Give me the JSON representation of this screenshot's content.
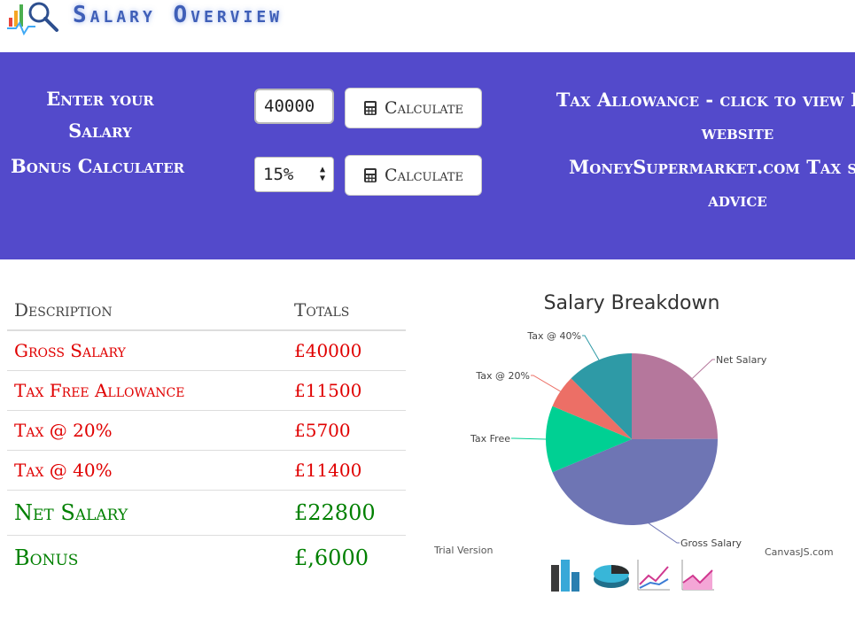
{
  "header": {
    "title": "Salary Overview",
    "logo_icon": "chart-magnifier-icon"
  },
  "banner": {
    "salary_label": "Enter your Salary",
    "salary_value": "40000",
    "bonus_label": "Bonus Calculater",
    "bonus_selected": "15%",
    "calc_button_label": "Calculate",
    "calc_icon": "calculator-icon",
    "links": [
      "Tax Allowance - click to view HMRC website",
      "MoneySupermarket.com Tax saving advice"
    ],
    "background": "#534acb"
  },
  "table": {
    "headers": [
      "Description",
      "Totals"
    ],
    "rows": [
      {
        "label": "Gross Salary",
        "value": "£40000",
        "color": "red"
      },
      {
        "label": "Tax Free Allowance",
        "value": "£11500",
        "color": "red"
      },
      {
        "label": "Tax @ 20%",
        "value": "£5700",
        "color": "red"
      },
      {
        "label": "Tax @ 40%",
        "value": "£11400",
        "color": "red"
      },
      {
        "label": "Net Salary",
        "value": "£22800",
        "color": "green"
      },
      {
        "label": "Bonus",
        "value": "£,6000",
        "color": "green"
      }
    ]
  },
  "chart": {
    "trial": "Trial Version",
    "credit": "CanvasJS.com",
    "toolbar_icons": [
      "bar-chart-icon",
      "pie-chart-icon",
      "line-chart-icon",
      "area-chart-icon"
    ]
  },
  "chart_data": {
    "type": "pie",
    "title": "Salary Breakdown",
    "labels": [
      "Net Salary",
      "Gross Salary",
      "Tax Free",
      "Tax @ 20%",
      "Tax @ 40%"
    ],
    "values": [
      22800,
      40000,
      11500,
      5700,
      11400
    ],
    "colors": [
      "#b5779c",
      "#6e75b4",
      "#00d093",
      "#ec6f66",
      "#2e9aa6"
    ]
  }
}
